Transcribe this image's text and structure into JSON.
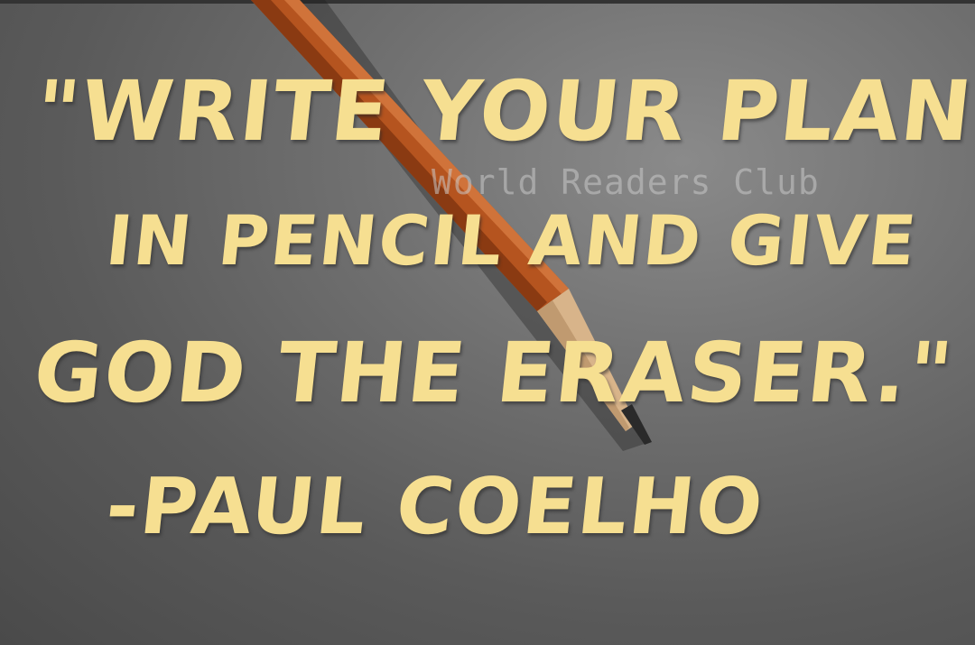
{
  "quote": {
    "line1": "\"Write your plans",
    "line2": "in pencil and give",
    "line3": "God the eraser.\"",
    "author": "-Paul Coelho"
  },
  "watermark": "World Readers Club",
  "colors": {
    "text": "#f6df91",
    "background": "#6f6f6f",
    "pencil_body": "#b5541f"
  }
}
